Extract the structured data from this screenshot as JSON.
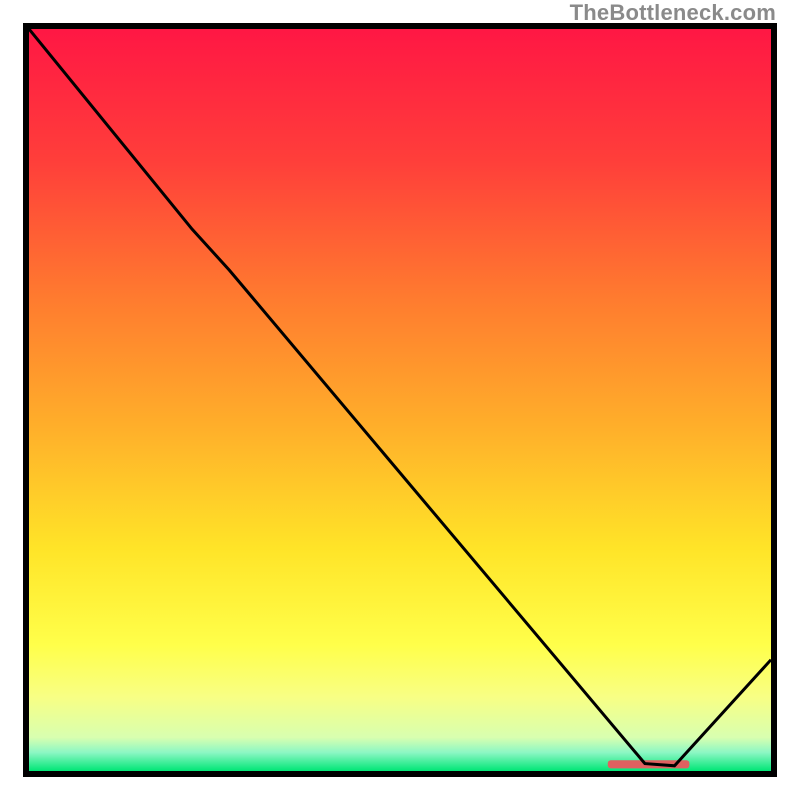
{
  "watermark": "TheBottleneck.com",
  "chart_data": {
    "type": "line",
    "title": "",
    "xlabel": "",
    "ylabel": "",
    "xlim": [
      0,
      100
    ],
    "ylim": [
      0,
      100
    ],
    "background_gradient": {
      "stops": [
        {
          "pos": 0.0,
          "color": "#ff1744"
        },
        {
          "pos": 0.18,
          "color": "#ff3f3a"
        },
        {
          "pos": 0.36,
          "color": "#ff7a2f"
        },
        {
          "pos": 0.54,
          "color": "#ffb02a"
        },
        {
          "pos": 0.7,
          "color": "#ffe428"
        },
        {
          "pos": 0.83,
          "color": "#ffff4a"
        },
        {
          "pos": 0.9,
          "color": "#f8ff84"
        },
        {
          "pos": 0.955,
          "color": "#d8ffb0"
        },
        {
          "pos": 0.975,
          "color": "#8cf7c4"
        },
        {
          "pos": 1.0,
          "color": "#00e676"
        }
      ]
    },
    "series": [
      {
        "name": "curve",
        "color": "#000000",
        "pts": [
          {
            "x": 0.0,
            "y": 100.0
          },
          {
            "x": 22.0,
            "y": 73.0
          },
          {
            "x": 27.0,
            "y": 67.5
          },
          {
            "x": 83.0,
            "y": 1.0
          },
          {
            "x": 87.0,
            "y": 0.7
          },
          {
            "x": 100.0,
            "y": 15.0
          }
        ]
      }
    ],
    "marker": {
      "color": "#e06060",
      "y": 0.9,
      "x_start": 78.0,
      "x_end": 89.0,
      "thickness_frac": 0.011
    }
  }
}
